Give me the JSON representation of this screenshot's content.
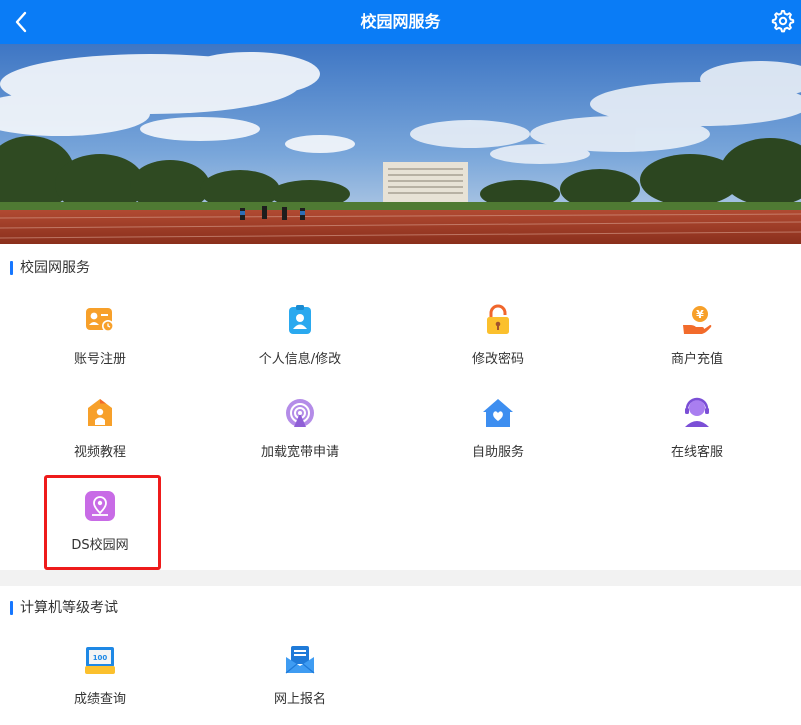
{
  "header": {
    "title": "校园网服务"
  },
  "sections": [
    {
      "title": "校园网服务",
      "items": [
        {
          "label": "账号注册",
          "icon": "id-card-clock-icon"
        },
        {
          "label": "个人信息/修改",
          "icon": "badge-person-icon"
        },
        {
          "label": "修改密码",
          "icon": "padlock-icon"
        },
        {
          "label": "商户充值",
          "icon": "yen-hand-icon"
        },
        {
          "label": "视频教程",
          "icon": "house-person-icon"
        },
        {
          "label": "加载宽带申请",
          "icon": "wifi-signal-icon"
        },
        {
          "label": "自助服务",
          "icon": "home-heart-icon"
        },
        {
          "label": "在线客服",
          "icon": "headset-agent-icon"
        },
        {
          "label": "DS校园网",
          "icon": "map-pin-icon"
        }
      ]
    },
    {
      "title": "计算机等级考试",
      "items": [
        {
          "label": "成绩查询",
          "icon": "score-screen-icon"
        },
        {
          "label": "网上报名",
          "icon": "mail-form-icon"
        }
      ]
    }
  ],
  "score_icon_text": "100",
  "colors": {
    "header": "#0a7cf6",
    "accent": "#1677ff",
    "highlight": "#ee1b1b"
  }
}
